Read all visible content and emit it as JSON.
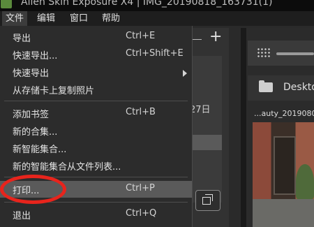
{
  "window": {
    "title": "Alien Skin Exposure X4 | IMG_20190818_163731(1)"
  },
  "menubar": {
    "items": [
      {
        "label": "文件"
      },
      {
        "label": "编辑"
      },
      {
        "label": "窗口"
      },
      {
        "label": "帮助"
      }
    ]
  },
  "file_menu": {
    "items": [
      {
        "label": "导出",
        "shortcut": "Ctrl+E"
      },
      {
        "label": "快速导出...",
        "shortcut": "Ctrl+Shift+E"
      },
      {
        "label": "快速导出",
        "shortcut": ""
      },
      {
        "label": "从存储卡上复制照片",
        "shortcut": ""
      },
      {
        "label": "添加书签",
        "shortcut": "Ctrl+B"
      },
      {
        "label": "新的合集...",
        "shortcut": ""
      },
      {
        "label": "新智能集合...",
        "shortcut": ""
      },
      {
        "label": "新的智能集合从文件列表...",
        "shortcut": ""
      },
      {
        "label": "打印...",
        "shortcut": "Ctrl+P"
      },
      {
        "label": "退出",
        "shortcut": "Ctrl+Q"
      }
    ]
  },
  "background": {
    "date_fragment": "27日",
    "folder_label": "Desktop",
    "thumbnail_caption": "...auty_2019080"
  },
  "annotation": {
    "color": "#e8241c"
  }
}
